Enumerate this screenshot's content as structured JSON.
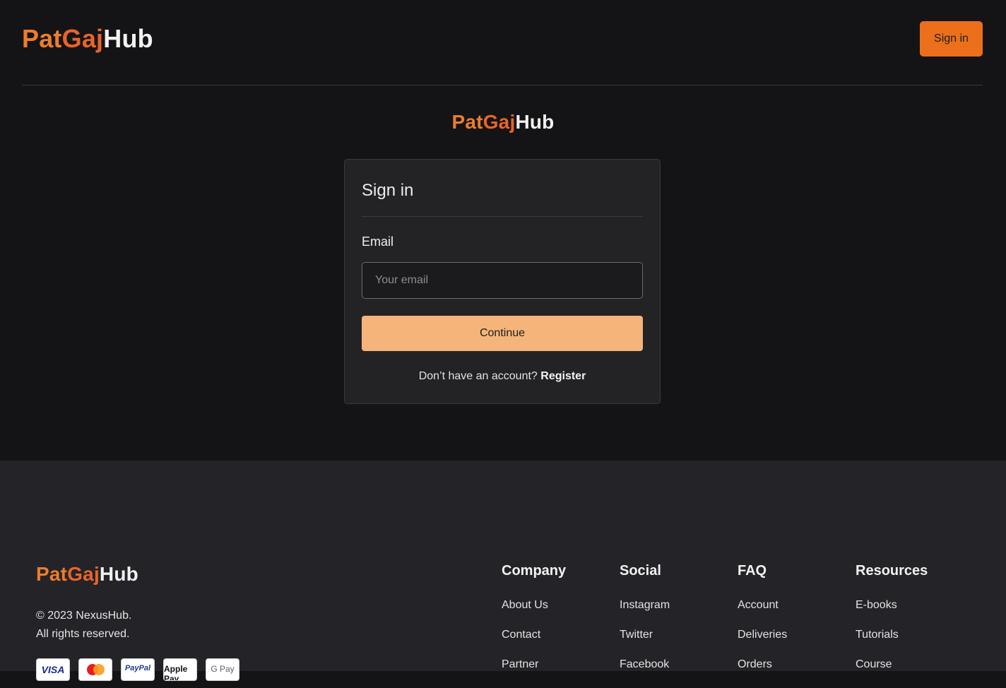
{
  "brand": {
    "part1": "Pat",
    "part2": "Gaj",
    "part3": "Hub"
  },
  "header": {
    "signin_label": "Sign in"
  },
  "card": {
    "title": "Sign in",
    "email_label": "Email",
    "email_placeholder": "Your email",
    "email_value": "",
    "continue_label": "Continue",
    "register_prompt": "Don’t have an account?",
    "register_link": "Register"
  },
  "footer": {
    "copyright_line1": "© 2023 NexusHub.",
    "copyright_line2": "All rights reserved.",
    "payment_methods": [
      "VISA",
      "Mastercard",
      "PayPal",
      "Apple Pay",
      "G Pay"
    ],
    "columns": [
      {
        "title": "Company",
        "links": [
          "About Us",
          "Contact",
          "Partner"
        ]
      },
      {
        "title": "Social",
        "links": [
          "Instagram",
          "Twitter",
          "Facebook"
        ]
      },
      {
        "title": "FAQ",
        "links": [
          "Account",
          "Deliveries",
          "Orders"
        ]
      },
      {
        "title": "Resources",
        "links": [
          "E-books",
          "Tutorials",
          "Course"
        ]
      }
    ]
  },
  "colors": {
    "accent": "#ec6f1c",
    "continue_button": "#f5b57a",
    "background": "#141416",
    "card": "#232325",
    "footer": "#232328"
  }
}
